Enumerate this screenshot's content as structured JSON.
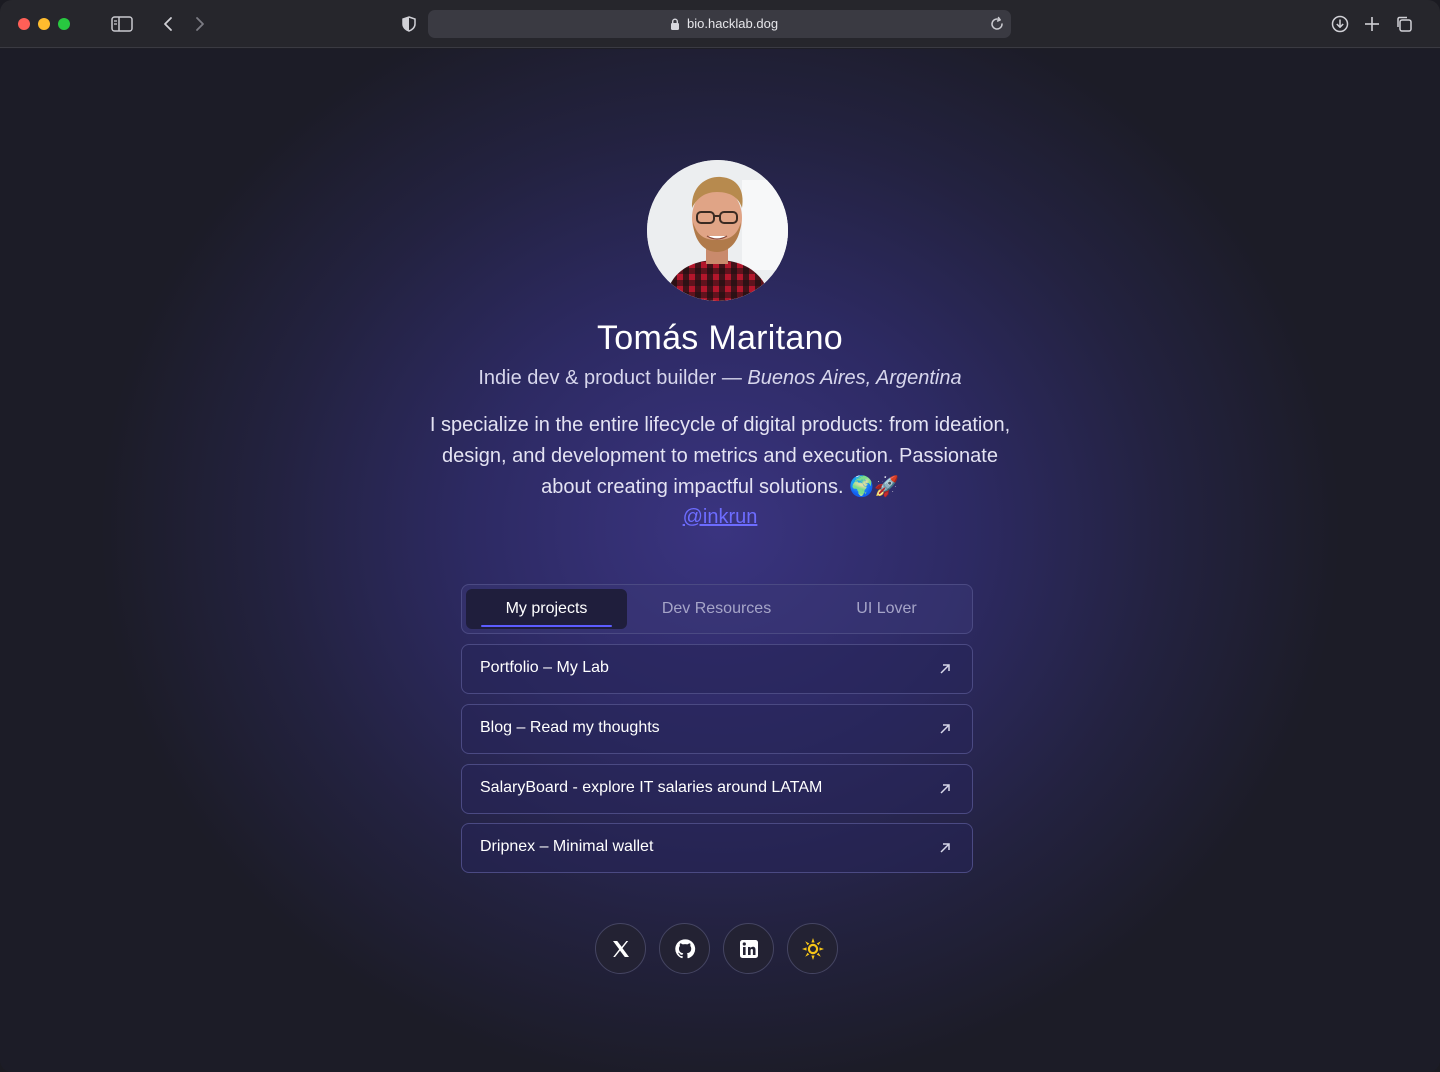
{
  "browser": {
    "url": "bio.hacklab.dog"
  },
  "profile": {
    "name": "Tomás Maritano",
    "role": "Indie dev & product builder —",
    "location": "Buenos Aires, Argentina",
    "bio": "I specialize in the entire lifecycle of digital products: from ideation, design, and development to metrics and execution. Passionate about creating impactful solutions. 🌍🚀",
    "handle": "@inkrun"
  },
  "tabs": [
    {
      "label": "My projects",
      "active": true
    },
    {
      "label": "Dev Resources",
      "active": false
    },
    {
      "label": "UI Lover",
      "active": false
    }
  ],
  "links": [
    {
      "label": "Portfolio – My Lab"
    },
    {
      "label": "Blog – Read my thoughts"
    },
    {
      "label": "SalaryBoard - explore IT salaries around LATAM"
    },
    {
      "label": "Dripnex – Minimal wallet"
    }
  ],
  "socials": [
    {
      "icon": "x-icon"
    },
    {
      "icon": "github-icon"
    },
    {
      "icon": "linkedin-icon"
    },
    {
      "icon": "sun-icon",
      "color": "#f5c518"
    }
  ]
}
